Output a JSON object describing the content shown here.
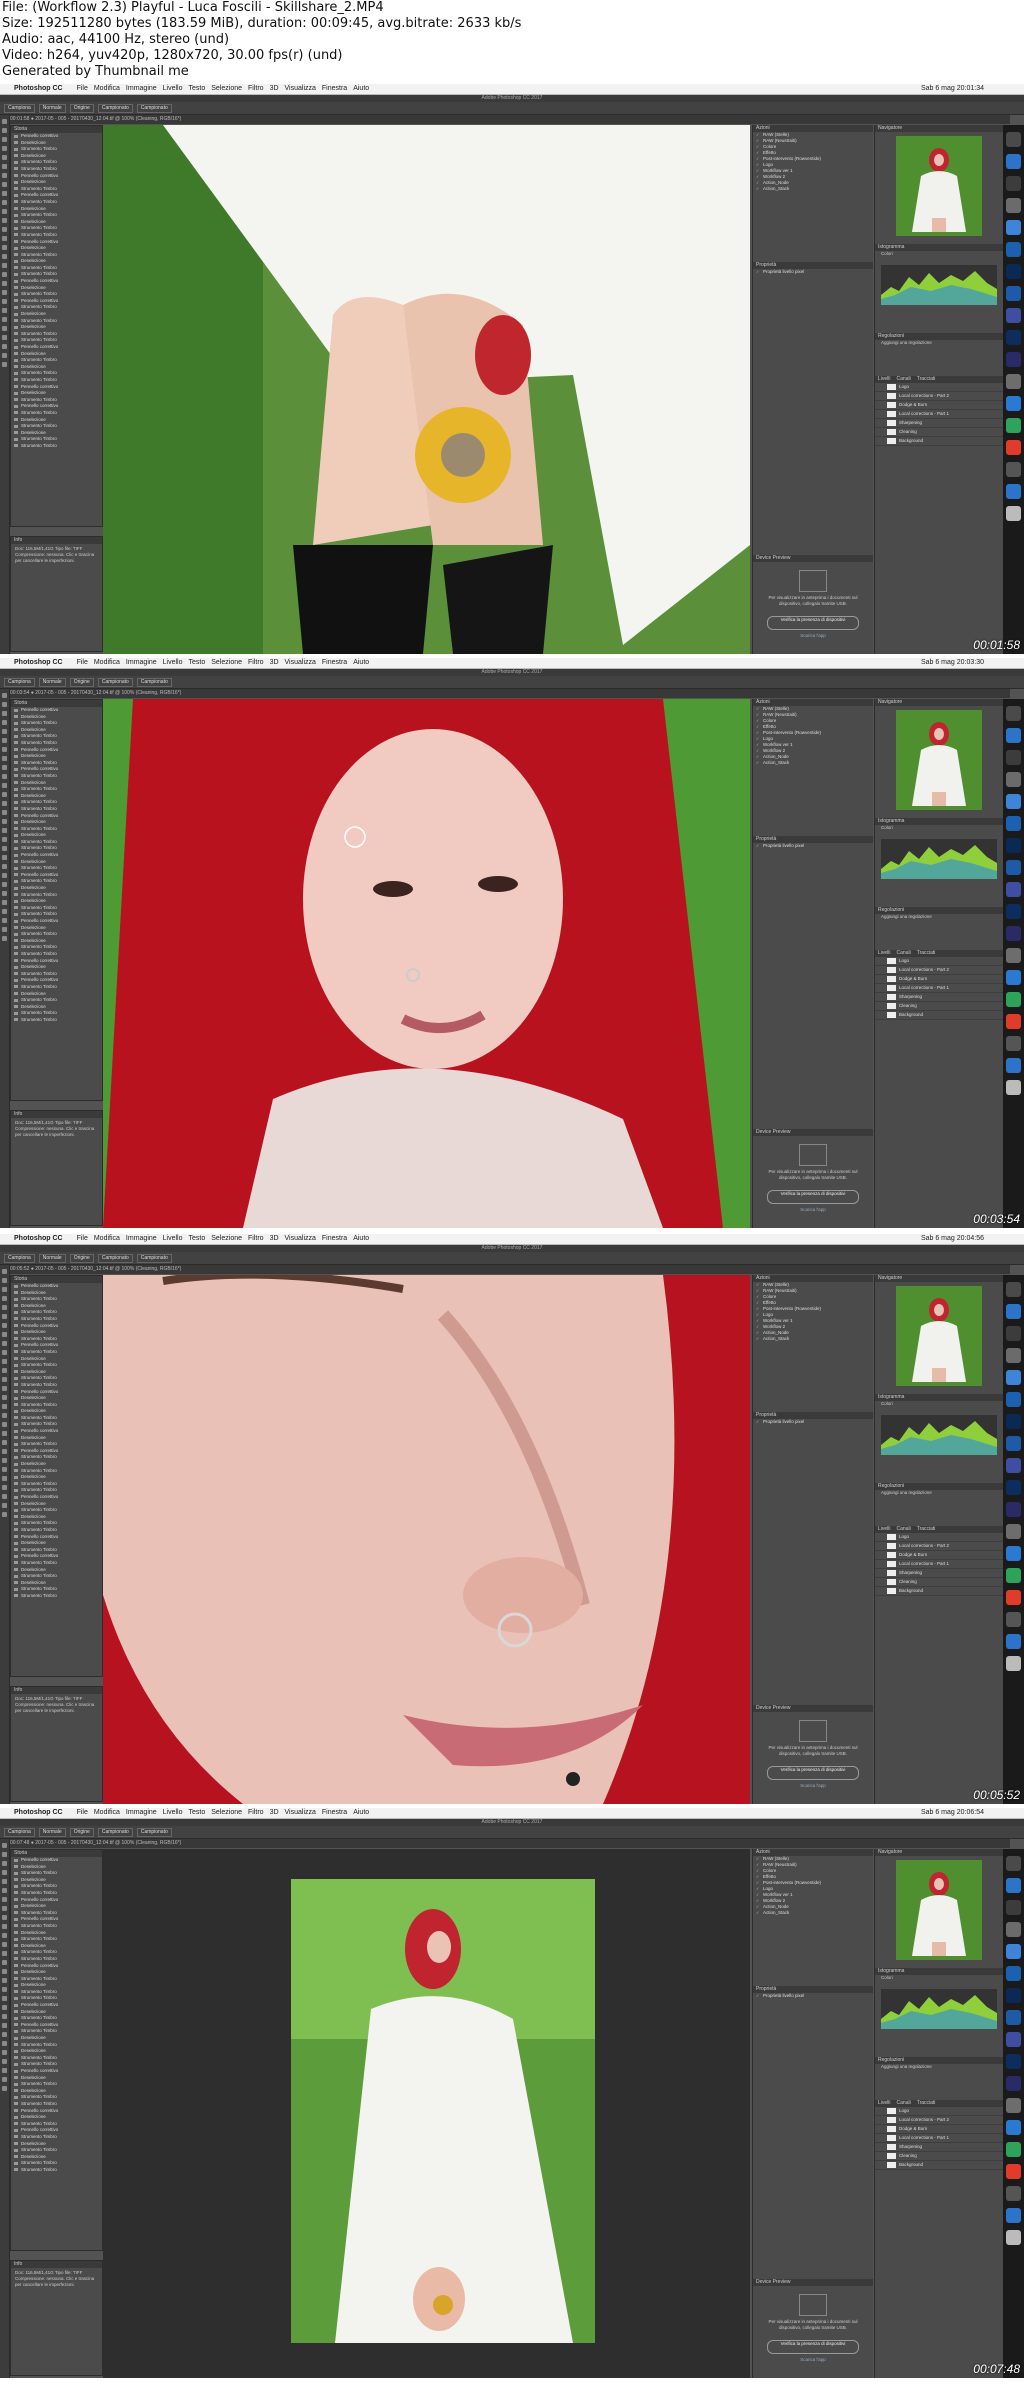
{
  "file_info": {
    "line1": "File: (Workflow 2.3) Playful - Luca Foscili - Skillshare_2.MP4",
    "line2": "Size: 192511280 bytes (183.59 MiB), duration: 00:09:45, avg.bitrate: 2633 kb/s",
    "line3": "Audio: aac, 44100 Hz, stereo (und)",
    "line4": "Video: h264, yuv420p, 1280x720, 30.00 fps(r) (und)",
    "line5": "Generated by Thumbnail me"
  },
  "menu": {
    "app": "Photoshop CC",
    "items": [
      "File",
      "Modifica",
      "Immagine",
      "Livello",
      "Testo",
      "Selezione",
      "Filtro",
      "3D",
      "Visualizza",
      "Finestra",
      "Aiuto"
    ]
  },
  "window_title": "Adobe Photoshop CC 2017",
  "options": [
    "Campiona",
    "Normale",
    "Origine",
    "Campionato",
    "Campionato"
  ],
  "frames": [
    {
      "timestamp": "00:01:58",
      "clock": "Sab 6 mag 20:01:34",
      "doc_tab": "00:01:58 ● 2017-05 - 005 - 20170430_12:04.tif @ 100% (Cleaning, RGB/16*)"
    },
    {
      "timestamp": "00:03:54",
      "clock": "Sab 6 mag 20:03:30",
      "doc_tab": "00:03:54 ● 2017-05 - 005 - 20170430_12:04.tif @ 100% (Cleaning, RGB/16*)"
    },
    {
      "timestamp": "00:05:52",
      "clock": "Sab 6 mag 20:04:56",
      "doc_tab": "00:05:52 ● 2017-05 - 005 - 20170430_12:04.tif @ 100% (Cleaning, RGB/16*)"
    },
    {
      "timestamp": "00:07:48",
      "clock": "Sab 6 mag 20:06:54",
      "doc_tab": "00:07:48 ● 2017-05 - 005 - 20170430_12:04.tif @ 100% (Cleaning, RGB/16*)"
    }
  ],
  "history_panel": {
    "title": "Storia",
    "items": [
      "Pennello correttivo",
      "Deselezione",
      "Strumento Timbro",
      "Deselezione",
      "Strumento Timbro",
      "Strumento Timbro",
      "Pennello correttivo",
      "Deselezione",
      "Strumento Timbro",
      "Pennello correttivo",
      "Strumento Timbro",
      "Deselezione",
      "Strumento Timbro",
      "Deselezione",
      "Strumento Timbro",
      "Strumento Timbro"
    ]
  },
  "info_panel": {
    "title": "Info",
    "text": "Doc: 116,5M/1,41G Tipo file: TIFF Compressione: nessuna. Clic e trascina per cancellare le imperfezioni."
  },
  "actions_panel": {
    "title": "Azioni",
    "items": [
      "RAW (Stelle)",
      "RAW (Neustraiti)",
      "Colore",
      "Effetto",
      "Post-intervento (Rowventide)",
      "Logo",
      "Workflow ver 1",
      "Workflow 2",
      "Action_Node",
      "Action_Stack"
    ]
  },
  "properties_panel": {
    "title": "Proprietà",
    "subtitle": "Proprietà livello pixel"
  },
  "device_preview": {
    "title": "Device Preview",
    "text": "Per visualizzare in anteprima i documenti sul dispositivo, collegalo tramite USB.",
    "button": "Verifica la presenza di dispositivi",
    "link": "Scarica l'app"
  },
  "navigator": {
    "title": "Navigatore"
  },
  "histogram": {
    "title": "Istogramma",
    "channel": "Colori"
  },
  "adjustments": {
    "title": "Regolazioni",
    "add": "Aggiungi una regolazione"
  },
  "layers": {
    "tabs": [
      "Livelli",
      "Canali",
      "Tracciati"
    ],
    "items": [
      "Logo",
      "Local corrections - Part 2",
      "Dodge & Burn",
      "Local corrections - Part 1",
      "Sharpening",
      "Cleaning",
      "Background"
    ]
  },
  "colors": {
    "ps_bg": "#535353",
    "panel": "#4b4b4b",
    "dark": "#2e2e2e",
    "accent": "#8fcf3c"
  }
}
